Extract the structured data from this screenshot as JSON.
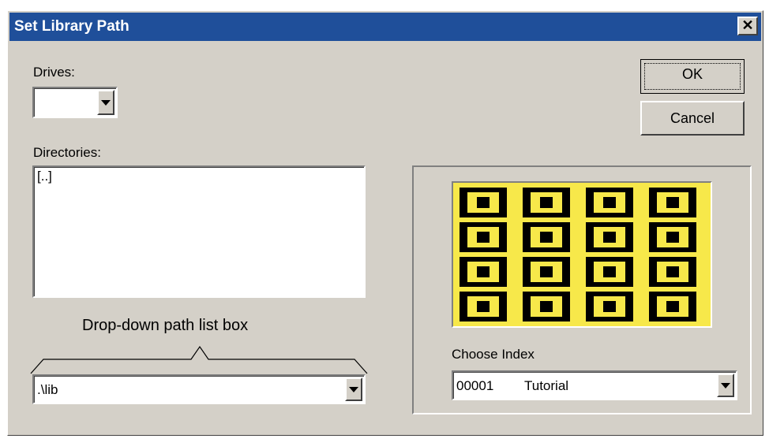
{
  "dialog": {
    "title": "Set Library Path",
    "close_symbol": "✕"
  },
  "drives": {
    "label": "Drives:",
    "value": ""
  },
  "directories": {
    "label": "Directories:",
    "items": [
      "[..]"
    ]
  },
  "annotation": {
    "text": "Drop-down path list box"
  },
  "path_dropdown": {
    "value": ".\\lib"
  },
  "buttons": {
    "ok": "OK",
    "cancel": "Cancel"
  },
  "index": {
    "label": "Choose Index",
    "value_number": "00001",
    "value_name": "Tutorial"
  },
  "preview": {
    "icon": "library-thumbnails-image",
    "colors": {
      "background": "#f7e84a",
      "foreground": "#000000"
    }
  }
}
